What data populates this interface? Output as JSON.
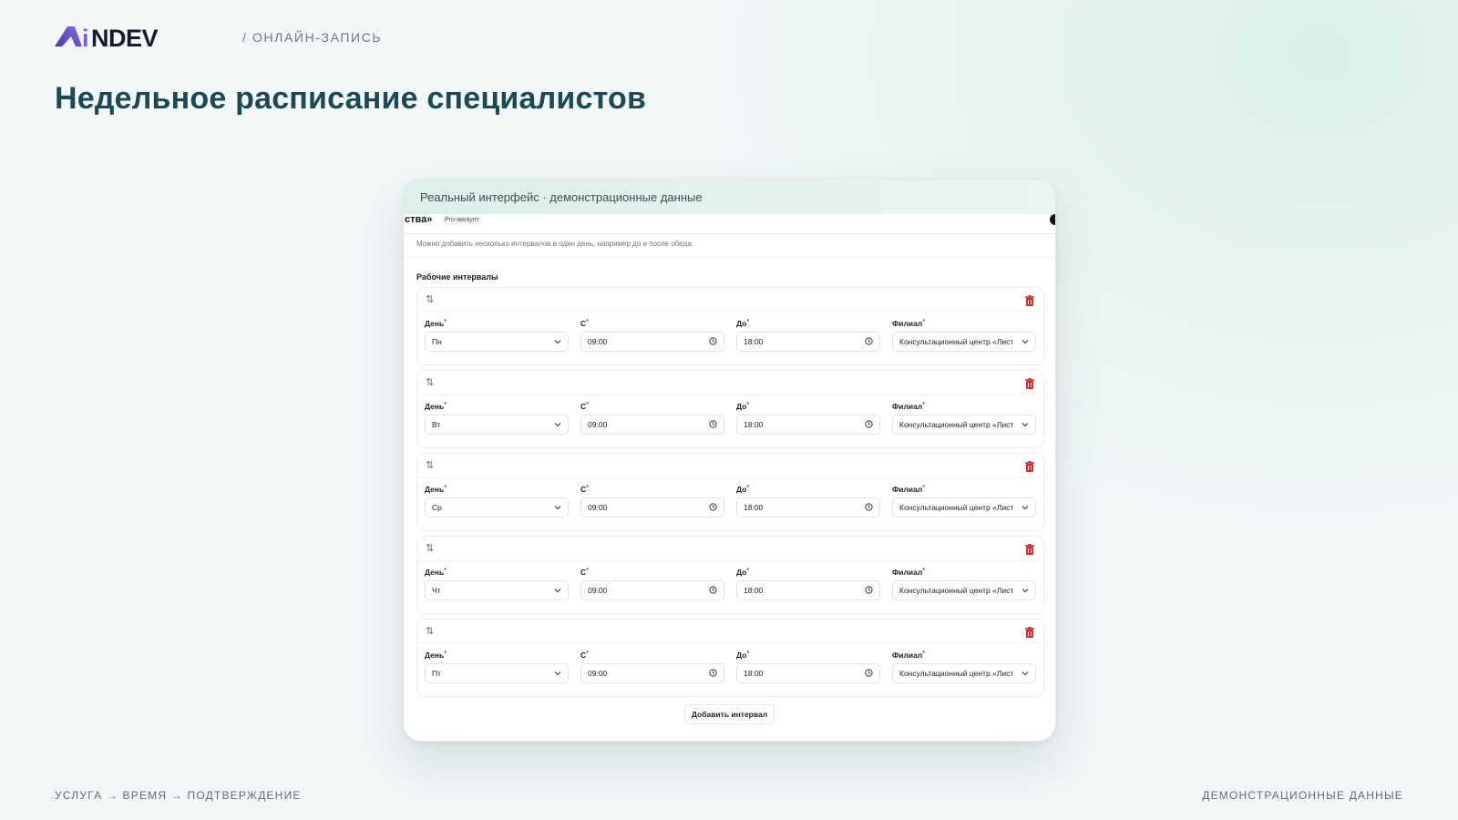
{
  "header": {
    "logo_text": "AiNDEV",
    "breadcrumb": "/ ОНЛАЙН-ЗАПИСЬ"
  },
  "page_title": "Недельное расписание специалистов",
  "frame": {
    "caption": "Реальный интерфейс · демонстрационные данные",
    "topbar_brand": "ства»",
    "topbar_badge": "Pro-аккаунт",
    "hint": "Можно добавить несколько интервалов в один день, например до и после обеда.",
    "section_label": "Рабочие интервалы",
    "field_labels": {
      "day": "День",
      "from": "С",
      "to": "До",
      "branch": "Филиал",
      "required_mark": "*"
    },
    "intervals": [
      {
        "day": "Пн",
        "from": "09:00",
        "to": "18:00",
        "branch": "Консультационный центр «Лист"
      },
      {
        "day": "Вт",
        "from": "09:00",
        "to": "18:00",
        "branch": "Консультационный центр «Лист"
      },
      {
        "day": "Ср",
        "from": "09:00",
        "to": "18:00",
        "branch": "Консультационный центр «Лист"
      },
      {
        "day": "Чт",
        "from": "09:00",
        "to": "18:00",
        "branch": "Консультационный центр «Лист"
      },
      {
        "day": "Пт",
        "from": "09:00",
        "to": "18:00",
        "branch": "Консультационный центр «Лист"
      }
    ],
    "add_button": "Добавить интервал"
  },
  "footer": {
    "steps": "УСЛУГА → ВРЕМЯ → ПОДТВЕРЖДЕНИЕ",
    "note": "ДЕМОНСТРАЦИОННЫЕ ДАННЫЕ"
  },
  "colors": {
    "title": "#1b4a55",
    "logo_accent": "#7b5cd6",
    "logo_dark": "#1a1a2e",
    "delete_icon": "#d32f2f"
  },
  "icons": {
    "drag": "sort-arrows-icon",
    "delete": "trash-icon",
    "select": "chevron-down-icon",
    "time": "clock-icon"
  }
}
